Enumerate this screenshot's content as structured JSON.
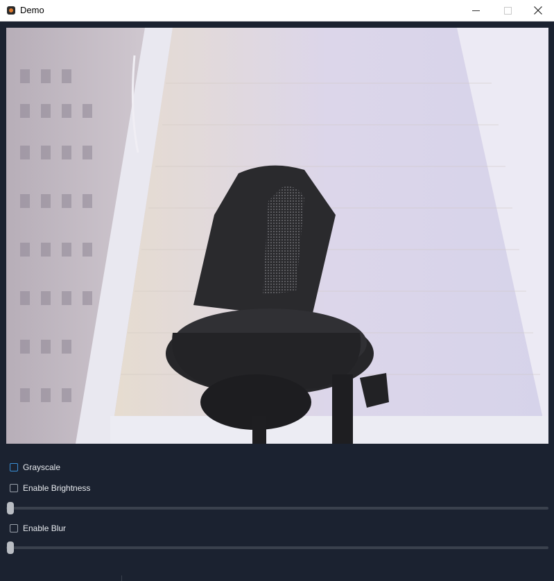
{
  "window": {
    "title": "Demo",
    "icon": "app-icon",
    "controls": [
      "minimize-icon",
      "maximize-icon",
      "close-icon"
    ]
  },
  "video_feed": {
    "description_icon": "camera-frame"
  },
  "controls": {
    "grayscale": {
      "label": "Grayscale",
      "checked": false
    },
    "brightness": {
      "label": "Enable Brightness",
      "checked": false,
      "slider_value": 0
    },
    "blur": {
      "label": "Enable Blur",
      "checked": false,
      "slider_value": 0
    }
  },
  "colors": {
    "background": "#1b2230",
    "focus_accent": "#3a8fd6"
  }
}
